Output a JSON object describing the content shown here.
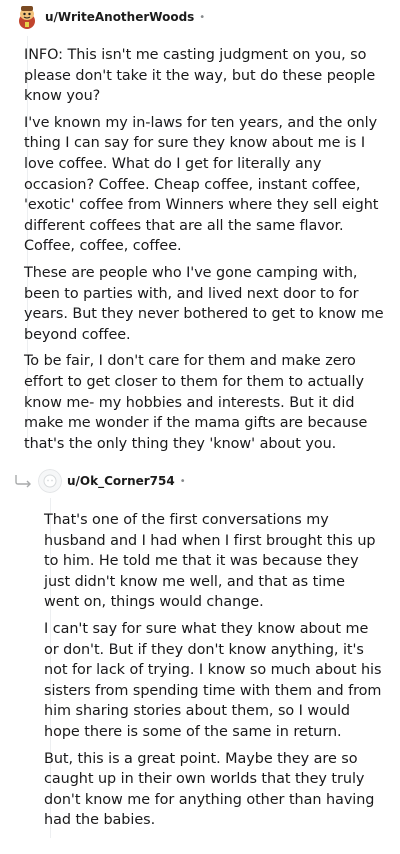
{
  "comments": [
    {
      "username": "u/WriteAnotherWoods",
      "separator": "•",
      "avatar_icon": "snoo-avatar-icon",
      "paragraphs": [
        "INFO: This isn't me casting judgment on you, so please don't take it the way, but do these people know you?",
        "I've known my in-laws for ten years, and the only thing I can say for sure they know about me is I love coffee. What do I get for literally any occasion? Coffee. Cheap coffee, instant coffee, 'exotic' coffee from Winners where they sell eight different coffees that are all the same flavor. Coffee, coffee, coffee.",
        "These are people who I've gone camping with, been to parties with, and lived next door to for years. But they never bothered to get to know me beyond coffee.",
        "To be fair, I don't care for them and make zero effort to get closer to them for them to actually know me- my hobbies and interests. But it did make me wonder if the mama gifts are because that's the only thing they 'know' about you."
      ]
    },
    {
      "username": "u/Ok_Corner754",
      "separator": "•",
      "avatar_icon": "default-avatar-icon",
      "reply_icon": "reply-arrow-icon",
      "paragraphs": [
        "That's one of the first conversations my husband and I had when I first brought this up to him. He told me that it was because they just didn't know me well, and that as time went on, things would change.",
        "I can't say for sure what they know about me or don't. But if they don't know anything, it's not for lack of trying. I know so much about his sisters from spending time with them and from him sharing stories about them, so I would hope there is some of the same in return.",
        "But, this is a great point. Maybe they are so caught up in their own worlds that they truly don't know me for anything other than having had the babies."
      ]
    }
  ]
}
